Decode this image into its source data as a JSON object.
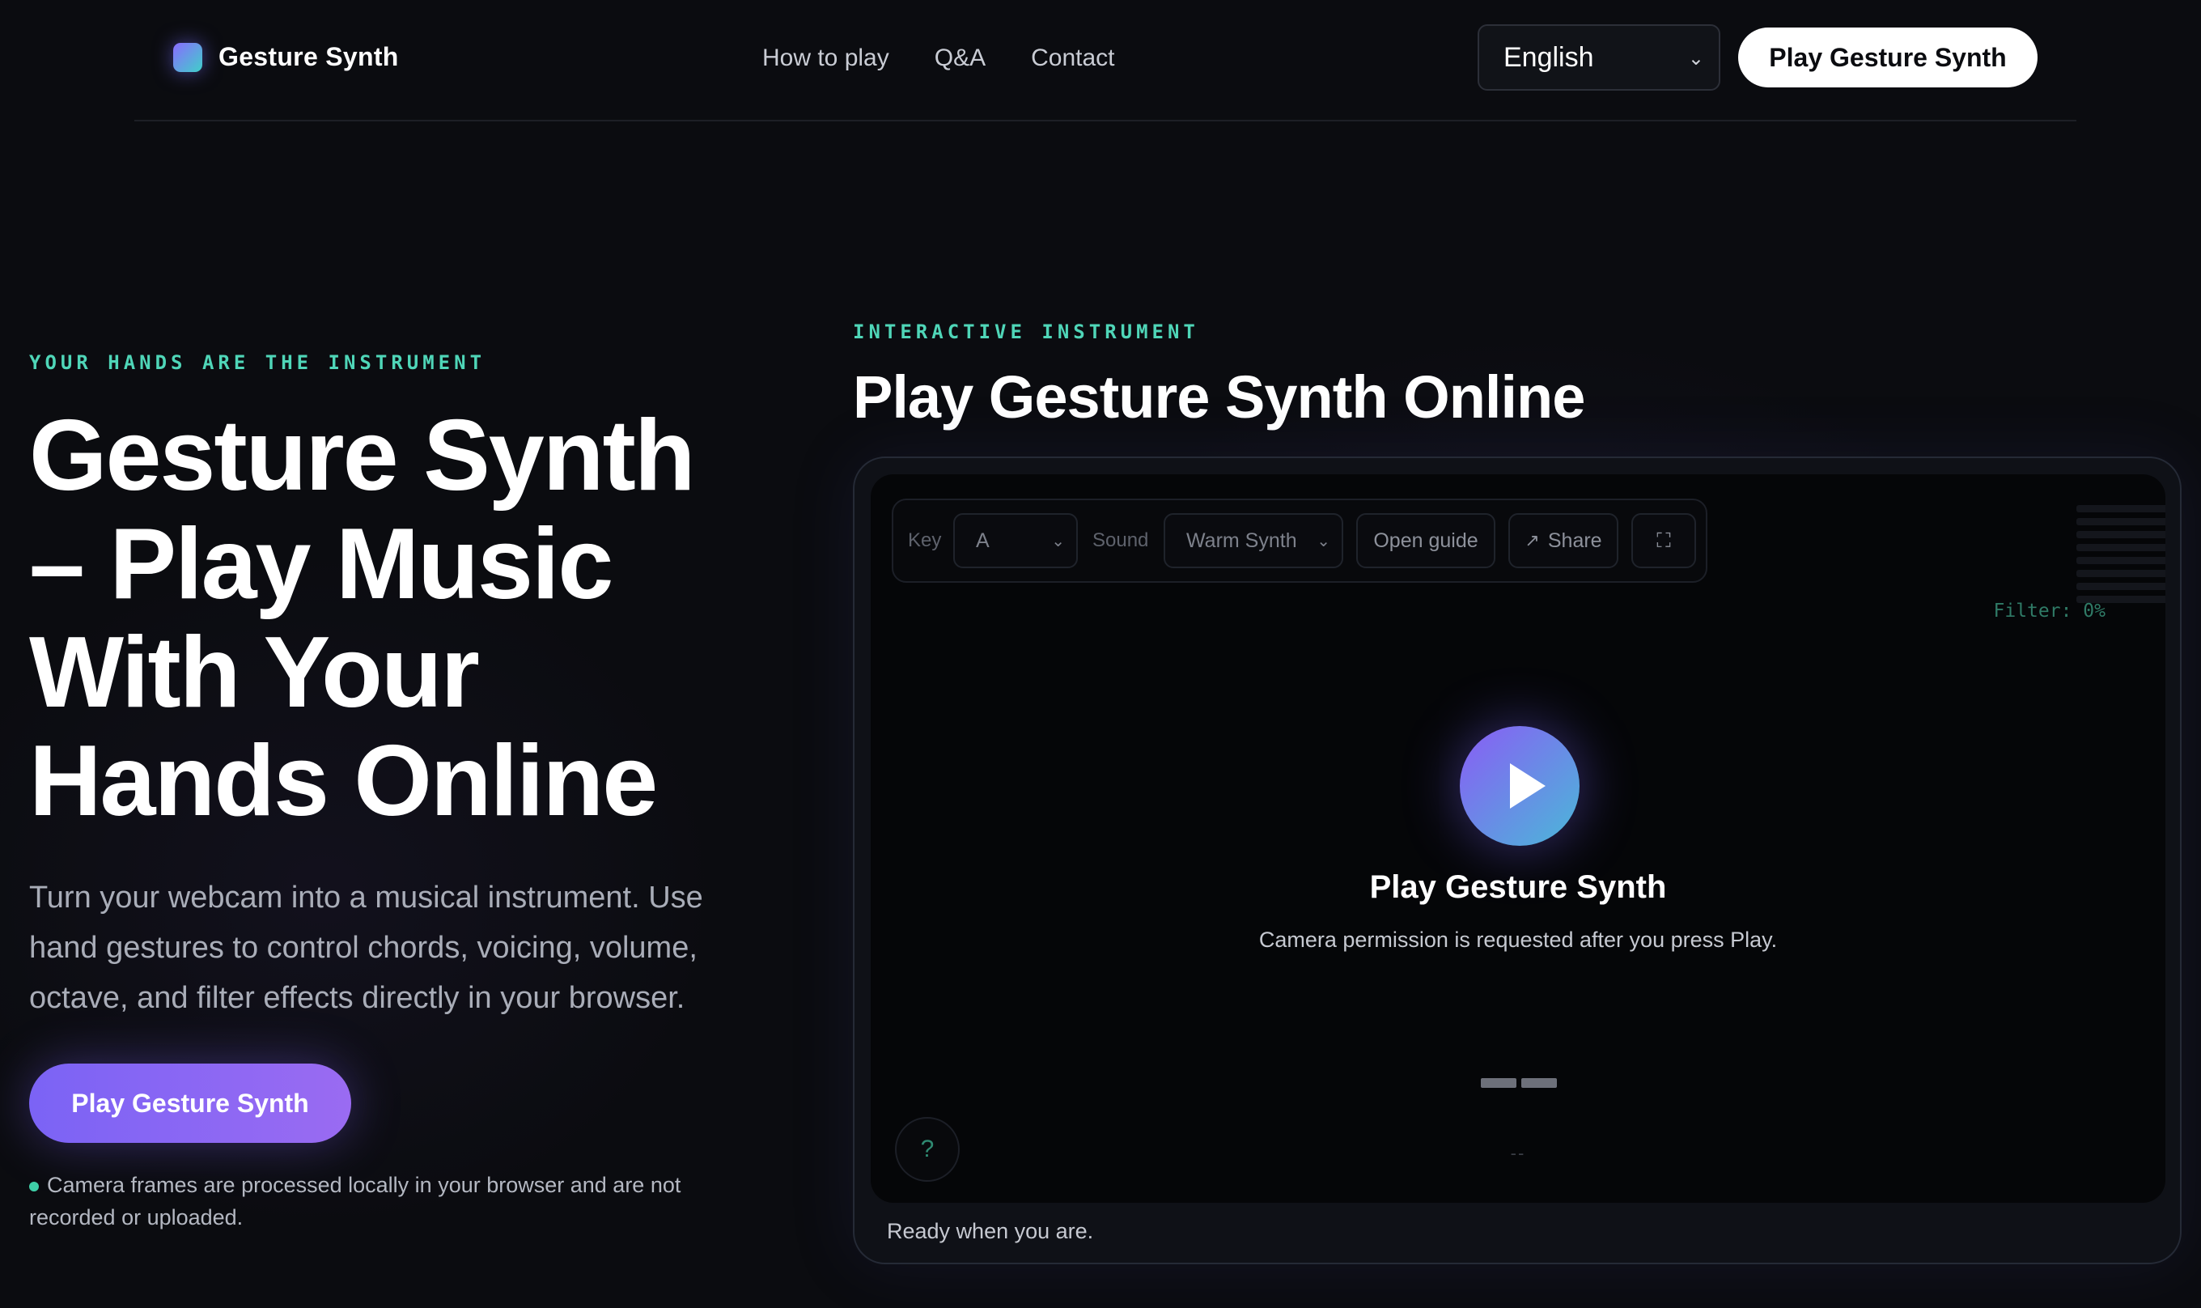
{
  "header": {
    "brand": "Gesture Synth",
    "nav": [
      "How to play",
      "Q&A",
      "Contact"
    ],
    "language": "English",
    "cta": "Play Gesture Synth"
  },
  "hero": {
    "eyebrow": "YOUR HANDS ARE THE INSTRUMENT",
    "title": "Gesture Synth – Play Music With Your Hands Online",
    "subtitle": "Turn your webcam into a musical instrument. Use hand gestures to control chords, voicing, volume, octave, and filter effects directly in your browser.",
    "cta": "Play Gesture Synth",
    "privacy": "Camera frames are processed locally in your browser and are not recorded or uploaded."
  },
  "instrument": {
    "eyebrow": "INTERACTIVE INSTRUMENT",
    "title": "Play Gesture Synth Online",
    "toolbar": {
      "key_label": "Key",
      "key_value": "A",
      "sound_label": "Sound",
      "sound_value": "Warm Synth",
      "guide": "Open guide",
      "share": "Share",
      "share_icon": "↗",
      "fullscreen_icon": "⛶"
    },
    "filter_readout": "Filter: 0%",
    "stage_title": "Play Gesture Synth",
    "stage_subtitle": "Camera permission is requested after you press Play.",
    "placeholder": "--",
    "help": "?",
    "status": "Ready when you are."
  },
  "colors": {
    "background": "#0b0c10",
    "accent_teal": "#4fd6b8",
    "accent_purple": "#7b63f5"
  }
}
